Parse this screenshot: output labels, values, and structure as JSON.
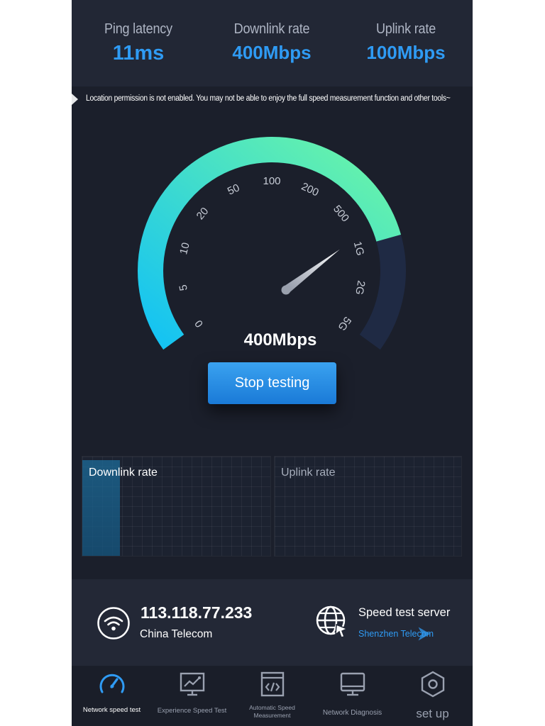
{
  "stats": {
    "ping": {
      "label": "Ping latency",
      "value": "11ms"
    },
    "downlink": {
      "label": "Downlink rate",
      "value": "400Mbps"
    },
    "uplink": {
      "label": "Uplink rate",
      "value": "100Mbps"
    }
  },
  "notice": "Location permission is not enabled. You may not be able to enjoy the full speed measurement function and other tools~",
  "gauge": {
    "ticks": [
      "0",
      "5",
      "10",
      "20",
      "50",
      "100",
      "200",
      "500",
      "1G",
      "2G",
      "5G"
    ],
    "current_value": "400Mbps",
    "current_tick_position": 7.1,
    "active_color_start": "#13c2f4",
    "active_color_end": "#6cf6a6",
    "inactive_color": "#1f2a44"
  },
  "stop_button": "Stop testing",
  "graphs": {
    "downlink_title": "Downlink rate",
    "uplink_title": "Uplink rate"
  },
  "connection": {
    "ip": "113.118.77.233",
    "isp": "China Telecom",
    "server_label": "Speed test server",
    "server_name": "Shenzhen Telecom"
  },
  "nav": [
    {
      "label": "Network speed test",
      "icon": "speedometer-icon",
      "active": true
    },
    {
      "label": "Experience Speed Test",
      "icon": "chart-screen-icon",
      "active": false
    },
    {
      "label": "Automatic Speed Measurement",
      "icon": "code-window-icon",
      "active": false
    },
    {
      "label": "Network Diagnosis",
      "icon": "monitor-icon",
      "active": false
    },
    {
      "label": "set up",
      "icon": "settings-hexagon-icon",
      "active": false
    }
  ],
  "colors": {
    "accent": "#2f9bf4",
    "background": "#1b1f2b",
    "panel": "#222735"
  }
}
